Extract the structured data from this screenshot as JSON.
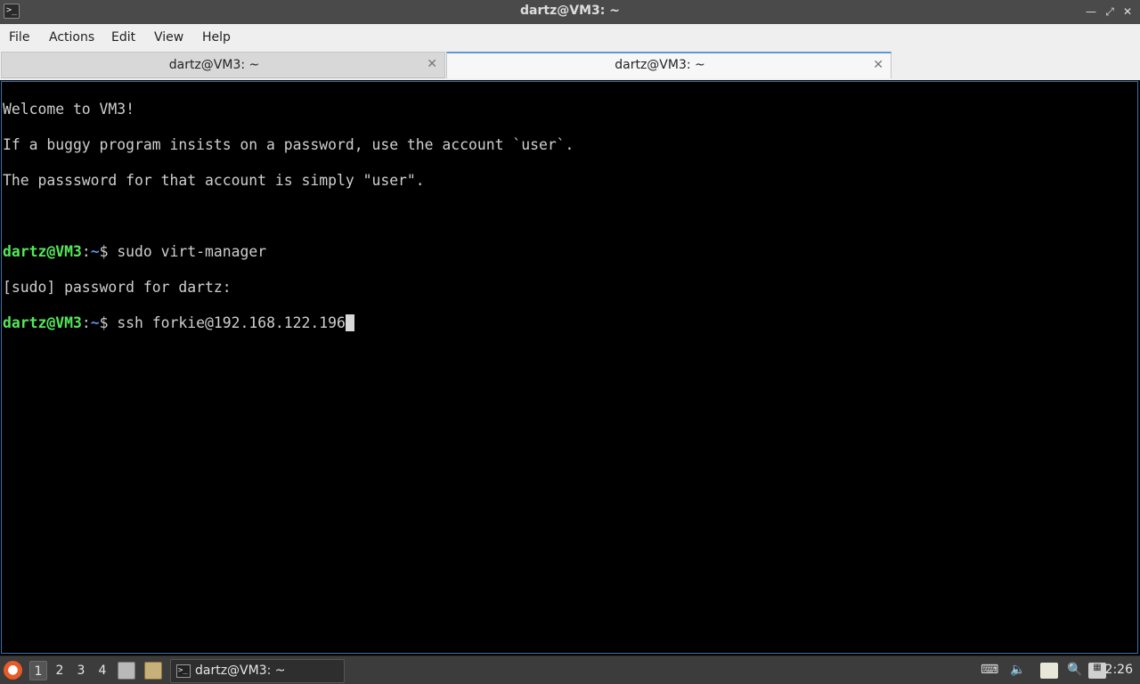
{
  "window": {
    "title": "dartz@VM3: ~",
    "app_icon_glyph": ">_"
  },
  "menu": {
    "items": [
      "File",
      "Actions",
      "Edit",
      "View",
      "Help"
    ]
  },
  "tabs": [
    {
      "label": "dartz@VM3: ~",
      "active": false
    },
    {
      "label": "dartz@VM3: ~",
      "active": true
    }
  ],
  "terminal": {
    "lines": [
      "Welcome to VM3!",
      "If a buggy program insists on a password, use the account `user`.",
      "The passsword for that account is simply \"user\".",
      ""
    ],
    "prompt1": {
      "user_host": "dartz@VM3",
      "sep": ":",
      "path": "~",
      "symbol": "$ ",
      "command": "sudo virt-manager"
    },
    "sudo_line": "[sudo] password for dartz:",
    "prompt2": {
      "user_host": "dartz@VM3",
      "sep": ":",
      "path": "~",
      "symbol": "$ ",
      "command": "ssh forkie@192.168.122.196"
    }
  },
  "taskbar": {
    "workspaces": [
      "1",
      "2",
      "3",
      "4"
    ],
    "current_workspace": "1",
    "task_label": "dartz@VM3: ~",
    "clock": "2:26"
  },
  "colors": {
    "prompt_user": "#54e85a",
    "prompt_path": "#5a8de6",
    "terminal_bg": "#000000",
    "active_tab_accent": "#5e9ad0"
  }
}
